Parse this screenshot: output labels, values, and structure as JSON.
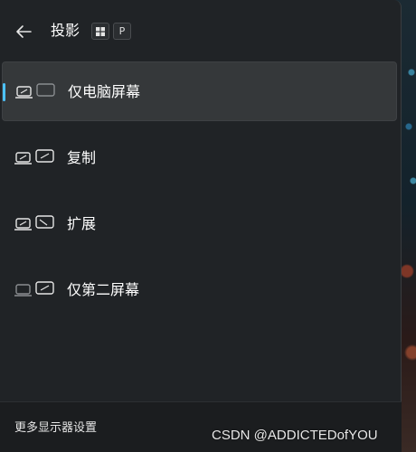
{
  "header": {
    "title": "投影",
    "back_icon": "arrow-left-icon",
    "shortcut": {
      "win_key_icon": "windows-logo-icon",
      "letter_key": "P"
    }
  },
  "options": [
    {
      "label": "仅电脑屏幕",
      "icon": "pc-screen-only-icon",
      "selected": true
    },
    {
      "label": "复制",
      "icon": "duplicate-icon",
      "selected": false
    },
    {
      "label": "扩展",
      "icon": "extend-icon",
      "selected": false
    },
    {
      "label": "仅第二屏幕",
      "icon": "second-screen-only-icon",
      "selected": false
    }
  ],
  "footer": {
    "link_label": "更多显示器设置"
  },
  "watermark": {
    "text": "CSDN @ADDICTEDofYOU"
  },
  "colors": {
    "accent": "#4cc2ff",
    "panel_bg": "#202326",
    "selected_bg": "#35383a",
    "text": "#ffffff"
  }
}
